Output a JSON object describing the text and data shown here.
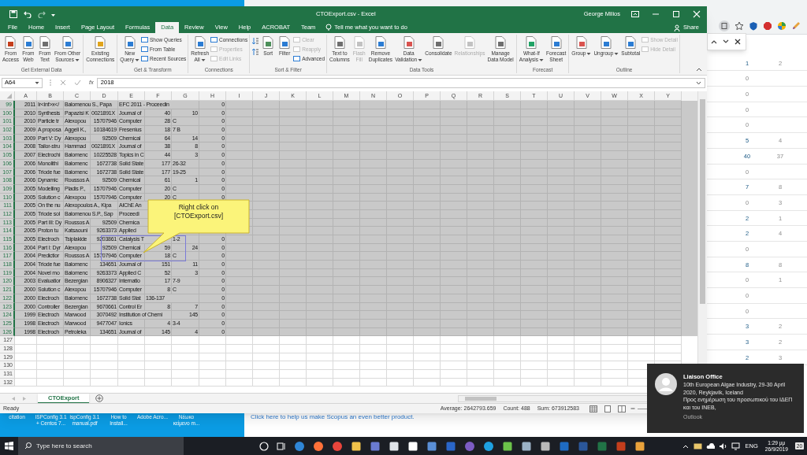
{
  "browser": {
    "rows": [
      {
        "values": [
          "1",
          "2"
        ],
        "linked": true
      },
      {
        "values": [
          "0"
        ],
        "linked": false
      },
      {
        "values": [
          "0"
        ],
        "linked": false
      },
      {
        "values": [
          "0"
        ],
        "linked": false
      },
      {
        "values": [
          "0"
        ],
        "linked": false
      },
      {
        "values": [
          "5",
          "4"
        ],
        "linked": true
      },
      {
        "values": [
          "40",
          "37"
        ],
        "linked": true
      },
      {
        "values": [
          "0"
        ],
        "linked": false
      },
      {
        "values": [
          "7",
          "8"
        ],
        "linked": true
      },
      {
        "values": [
          "0",
          "3"
        ],
        "linked": false
      },
      {
        "values": [
          "2",
          "1"
        ],
        "linked": true
      },
      {
        "values": [
          "2",
          "4"
        ],
        "linked": true
      },
      {
        "values": [
          "0"
        ],
        "linked": false
      },
      {
        "values": [
          "8",
          "8"
        ],
        "linked": true
      },
      {
        "values": [
          "0",
          "1"
        ],
        "linked": false
      },
      {
        "values": [
          "0"
        ],
        "linked": false
      },
      {
        "values": [
          "0"
        ],
        "linked": false
      },
      {
        "values": [
          "3",
          "2"
        ],
        "linked": true
      },
      {
        "values": [
          "3",
          "2"
        ],
        "linked": true
      },
      {
        "values": [
          "2",
          "3"
        ],
        "linked": true
      }
    ],
    "feedback_link": "Click here to help us make Scopus an even better product."
  },
  "excel": {
    "title": "CTOExport.csv - Excel",
    "user": "George Milios",
    "tabs": [
      {
        "label": "File",
        "selected": false
      },
      {
        "label": "Home",
        "selected": false
      },
      {
        "label": "Insert",
        "selected": false
      },
      {
        "label": "Page Layout",
        "selected": false
      },
      {
        "label": "Formulas",
        "selected": false
      },
      {
        "label": "Data",
        "selected": true
      },
      {
        "label": "Review",
        "selected": false
      },
      {
        "label": "View",
        "selected": false
      },
      {
        "label": "Help",
        "selected": false
      },
      {
        "label": "ACROBAT",
        "selected": false
      },
      {
        "label": "Team",
        "selected": false
      }
    ],
    "tell_me": "Tell me what you want to do",
    "share": "Share",
    "ribbon_groups": [
      {
        "label": "Get External Data",
        "items": [
          {
            "kind": "large",
            "lines": [
              "From",
              "Access"
            ],
            "menu": false,
            "disabled": false
          },
          {
            "kind": "large",
            "lines": [
              "From",
              "Web"
            ],
            "menu": false,
            "disabled": false
          },
          {
            "kind": "large",
            "lines": [
              "From",
              "Text"
            ],
            "menu": false,
            "disabled": false
          },
          {
            "kind": "large",
            "lines": [
              "From Other",
              "Sources"
            ],
            "menu": true,
            "disabled": false
          }
        ]
      },
      {
        "items": [
          {
            "kind": "large",
            "lines": [
              "Existing",
              "Connections"
            ],
            "menu": false,
            "disabled": false
          }
        ]
      },
      {
        "label": "Get & Transform",
        "items": [
          {
            "kind": "large",
            "lines": [
              "New",
              "Query"
            ],
            "menu": true,
            "disabled": false
          },
          {
            "kind": "stack",
            "items": [
              {
                "label": "Show Queries",
                "disabled": false
              },
              {
                "label": "From Table",
                "disabled": false
              },
              {
                "label": "Recent Sources",
                "disabled": false
              }
            ]
          }
        ]
      },
      {
        "label": "Connections",
        "items": [
          {
            "kind": "large",
            "lines": [
              "Refresh",
              "All"
            ],
            "menu": true,
            "disabled": false
          },
          {
            "kind": "stack",
            "items": [
              {
                "label": "Connections",
                "disabled": false
              },
              {
                "label": "Properties",
                "disabled": true
              },
              {
                "label": "Edit Links",
                "disabled": true
              }
            ]
          }
        ]
      },
      {
        "label": "Sort & Filter",
        "items": [
          {
            "kind": "sort_pair"
          },
          {
            "kind": "large",
            "lines": [
              "Sort"
            ],
            "menu": false,
            "disabled": false
          },
          {
            "kind": "large",
            "lines": [
              "Filter"
            ],
            "menu": false,
            "disabled": false
          },
          {
            "kind": "stack",
            "items": [
              {
                "label": "Clear",
                "disabled": true
              },
              {
                "label": "Reapply",
                "disabled": true
              },
              {
                "label": "Advanced",
                "disabled": false
              }
            ]
          }
        ]
      },
      {
        "label": "Data Tools",
        "items": [
          {
            "kind": "large",
            "lines": [
              "Text to",
              "Columns"
            ],
            "menu": false,
            "disabled": false
          },
          {
            "kind": "large",
            "lines": [
              "Flash",
              "Fill"
            ],
            "menu": false,
            "disabled": true
          },
          {
            "kind": "large",
            "lines": [
              "Remove",
              "Duplicates"
            ],
            "menu": false,
            "disabled": false
          },
          {
            "kind": "large",
            "lines": [
              "Data",
              "Validation"
            ],
            "menu": true,
            "disabled": false
          },
          {
            "kind": "large",
            "lines": [
              "Consolidate"
            ],
            "menu": false,
            "disabled": false
          },
          {
            "kind": "large",
            "lines": [
              "Relationships"
            ],
            "menu": false,
            "disabled": true
          },
          {
            "kind": "large",
            "lines": [
              "Manage",
              "Data Model"
            ],
            "menu": false,
            "disabled": false
          }
        ]
      },
      {
        "label": "Forecast",
        "items": [
          {
            "kind": "large",
            "lines": [
              "What-If",
              "Analysis"
            ],
            "menu": true,
            "disabled": false
          },
          {
            "kind": "large",
            "lines": [
              "Forecast",
              "Sheet"
            ],
            "menu": false,
            "disabled": false
          }
        ]
      },
      {
        "label": "Outline",
        "items": [
          {
            "kind": "large",
            "lines": [
              "Group"
            ],
            "menu": true,
            "disabled": false
          },
          {
            "kind": "large",
            "lines": [
              "Ungroup"
            ],
            "menu": true,
            "disabled": false
          },
          {
            "kind": "large",
            "lines": [
              "Subtotal"
            ],
            "menu": false,
            "disabled": false
          },
          {
            "kind": "stack",
            "items": [
              {
                "label": "Show Detail",
                "disabled": true
              },
              {
                "label": "Hide Detail",
                "disabled": true
              }
            ]
          }
        ]
      }
    ],
    "name_box": "A64",
    "function_label": "fx",
    "formula": "2018",
    "columns": [
      "A",
      "B",
      "C",
      "D",
      "E",
      "F",
      "G",
      "H",
      "I",
      "J",
      "K",
      "L",
      "M",
      "N",
      "O",
      "P",
      "Q",
      "R",
      "S",
      "T",
      "U",
      "V",
      "W",
      "X",
      "Y"
    ],
    "rows": [
      {
        "number": "99",
        "selected": true,
        "cells": {
          "a": "2011",
          "b": "Ir<inf>x</",
          "c": "Balomenou S., Papa",
          "e": "EFC 2011 - Proceedin",
          "h": "0"
        }
      },
      {
        "number": "100",
        "selected": true,
        "cells": {
          "a": "2010",
          "b": "Synthesis",
          "c": "Papazisi K",
          "d": "0021891X",
          "e": "Journal of",
          "f": "40",
          "g": "10",
          "h": "0"
        }
      },
      {
        "number": "101",
        "selected": true,
        "cells": {
          "a": "2010",
          "b": "Particle tr",
          "c": "Alexopou",
          "d": "15707946",
          "e": "Computer",
          "f": "28",
          "g": "C",
          "h": "0"
        }
      },
      {
        "number": "102",
        "selected": true,
        "cells": {
          "a": "2009",
          "b": "A proposa",
          "c": "Aggeli K.,",
          "d": "10184619",
          "e": "Fresenius",
          "f": "18",
          "g": "7 B",
          "h": "0"
        }
      },
      {
        "number": "103",
        "selected": true,
        "cells": {
          "a": "2009",
          "b": "Part V: Dy",
          "c": "Alexopou",
          "d": "92509",
          "e": "Chemical",
          "f": "64",
          "g": "14",
          "h": "0"
        }
      },
      {
        "number": "104",
        "selected": true,
        "cells": {
          "a": "2008",
          "b": "Tailor-stru",
          "c": "Hammad",
          "d": "0021891X",
          "e": "Journal of",
          "f": "38",
          "g": "8",
          "h": "0"
        }
      },
      {
        "number": "105",
        "selected": true,
        "cells": {
          "a": "2007",
          "b": "Electrochi",
          "c": "Balomenc",
          "d": "10225528",
          "e": "Topics in C",
          "f": "44",
          "g": "3",
          "h": "0"
        }
      },
      {
        "number": "106",
        "selected": true,
        "cells": {
          "a": "2006",
          "b": "Monolithi",
          "c": "Balomenc",
          "d": "1672738",
          "e": "Solid State",
          "f": "177",
          "g": "26-32",
          "h": "0"
        }
      },
      {
        "number": "107",
        "selected": true,
        "cells": {
          "a": "2006",
          "b": "Triode fue",
          "c": "Balomenc",
          "d": "1672738",
          "e": "Solid State",
          "f": "177",
          "g": "19-25",
          "h": "0"
        }
      },
      {
        "number": "108",
        "selected": true,
        "cells": {
          "a": "2006",
          "b": "Dynamic",
          "c": "Roussos A",
          "d": "92509",
          "e": "Chemical",
          "f": "61",
          "g": "1",
          "h": "0"
        }
      },
      {
        "number": "109",
        "selected": true,
        "cells": {
          "a": "2005",
          "b": "Modelling",
          "c": "Pladis P.,",
          "d": "15707946",
          "e": "Computer",
          "f": "20",
          "g": "C",
          "h": "0"
        }
      },
      {
        "number": "110",
        "selected": true,
        "cells": {
          "a": "2005",
          "b": "Solution c",
          "c": "Alexopou",
          "d": "15707946",
          "e": "Computer",
          "f": "20",
          "g": "C",
          "h": "0"
        }
      },
      {
        "number": "111",
        "selected": true,
        "cells": {
          "a": "2005",
          "b": "On the nu",
          "c": "Alexopoulos A., Kipa",
          "e": "AIChE An"
        }
      },
      {
        "number": "112",
        "selected": true,
        "cells": {
          "a": "2005",
          "b": "Triode sol",
          "c": "Balomenou S.P., Sap",
          "e": "Proceedi"
        }
      },
      {
        "number": "113",
        "selected": true,
        "cells": {
          "a": "2005",
          "b": "Part III: Dy",
          "c": "Roussos A",
          "d": "92509",
          "e": "Chemica"
        }
      },
      {
        "number": "114",
        "selected": true,
        "cells": {
          "a": "2005",
          "b": "Proton tu",
          "c": "Katsaouni",
          "d": "9263373",
          "e": "Applied"
        }
      },
      {
        "number": "115",
        "selected": true,
        "cells": {
          "a": "2005",
          "b": "Electroch",
          "c": "Tsiplakide",
          "d": "9203861",
          "e": "Catalysis T",
          "g": "1-2",
          "h": "0"
        }
      },
      {
        "number": "116",
        "selected": true,
        "cells": {
          "a": "2004",
          "b": "Part I: Dyr",
          "c": "Alexopou",
          "d": "92509",
          "e": "Chemical",
          "f": "59",
          "g": "24",
          "h": "0"
        }
      },
      {
        "number": "117",
        "selected": true,
        "cells": {
          "a": "2004",
          "b": "Predictior",
          "c": "Roussos A",
          "d": "15707946",
          "e": "Computer",
          "f": "18",
          "g": "C",
          "h": "0"
        }
      },
      {
        "number": "118",
        "selected": true,
        "cells": {
          "a": "2004",
          "b": "Triode fue",
          "c": "Balomenc",
          "d": "134651",
          "e": "Journal of",
          "f": "151",
          "g": "11",
          "h": "0"
        }
      },
      {
        "number": "119",
        "selected": true,
        "cells": {
          "a": "2004",
          "b": "Novel mo",
          "c": "Balomenc",
          "d": "9263373",
          "e": "Applied C",
          "f": "52",
          "g": "3",
          "h": "0"
        }
      },
      {
        "number": "120",
        "selected": true,
        "cells": {
          "a": "2003",
          "b": "Evaluatior",
          "c": "Bezergian",
          "d": "8906327",
          "e": "Internatio",
          "f": "17",
          "g": "7-9",
          "h": "0"
        }
      },
      {
        "number": "121",
        "selected": true,
        "cells": {
          "a": "2000",
          "b": "Solution c",
          "c": "Alexopou",
          "d": "15707946",
          "e": "Computer",
          "f": "8",
          "g": "C",
          "h": "0"
        }
      },
      {
        "number": "122",
        "selected": true,
        "cells": {
          "a": "2000",
          "b": "Electroch",
          "c": "Balomenc",
          "d": "1672738",
          "e": "Solid Stat",
          "f": "136-137",
          "h": "0"
        }
      },
      {
        "number": "123",
        "selected": true,
        "cells": {
          "a": "2000",
          "b": "Controller",
          "c": "Bezergian",
          "d": "9670661",
          "e": "Control Er",
          "f": "8",
          "g": "7",
          "h": "0"
        }
      },
      {
        "number": "124",
        "selected": true,
        "cells": {
          "a": "1999",
          "b": "Electroch",
          "c": "Marwood",
          "d": "3070492",
          "e": "Institution of Chemi",
          "g": "145",
          "h": "0"
        }
      },
      {
        "number": "125",
        "selected": true,
        "cells": {
          "a": "1998",
          "b": "Electroch",
          "c": "Marwood",
          "d": "9477047",
          "e": "Ionics",
          "f": "4",
          "g": "3-4",
          "h": "0"
        }
      },
      {
        "number": "126",
        "selected": true,
        "cells": {
          "a": "1998",
          "b": "Electroch",
          "c": "Petroleka",
          "d": "134651",
          "e": "Journal of",
          "f": "145",
          "g": "4",
          "h": "0"
        }
      },
      {
        "number": "127",
        "selected": false
      },
      {
        "number": "128",
        "selected": false
      },
      {
        "number": "129",
        "selected": false
      },
      {
        "number": "130",
        "selected": false
      },
      {
        "number": "131",
        "selected": false
      },
      {
        "number": "132",
        "selected": false
      }
    ],
    "callout": "Right click on [CTOExport.csv]",
    "sheet_tabs": [
      {
        "label": "CTOExport",
        "selected": true
      }
    ],
    "status": "Ready",
    "stats": [
      "Average: 2642793.659",
      "Count: 488",
      "Sum: 673912583"
    ]
  },
  "desktop_icons": [
    {
      "lines": [
        "citation"
      ]
    },
    {
      "lines": [
        "ISPConfig 3.1",
        "+ Centos 7..."
      ]
    },
    {
      "lines": [
        "ispConfig 3.1",
        "manual.pdf"
      ]
    },
    {
      "lines": [
        "How to",
        "Install..."
      ]
    },
    {
      "lines": [
        "Adobe Acro..."
      ]
    },
    {
      "lines": [
        "Νέωκο",
        "κείμενο m..."
      ]
    }
  ],
  "taskbar": {
    "search_placeholder": "Type here to search",
    "language": "ENG",
    "time": "1:29 μμ",
    "date": "26/9/2019",
    "notifications": "20"
  },
  "toast": {
    "title": "Liaison Office",
    "body": [
      "10th European Algae Industry, 29-30 April 2020, Reykjavik, Iceland",
      "Προς ενημέρωση του προσωπικού του ΙΔΕΠ και του INEB,"
    ],
    "app": "Outlook"
  }
}
